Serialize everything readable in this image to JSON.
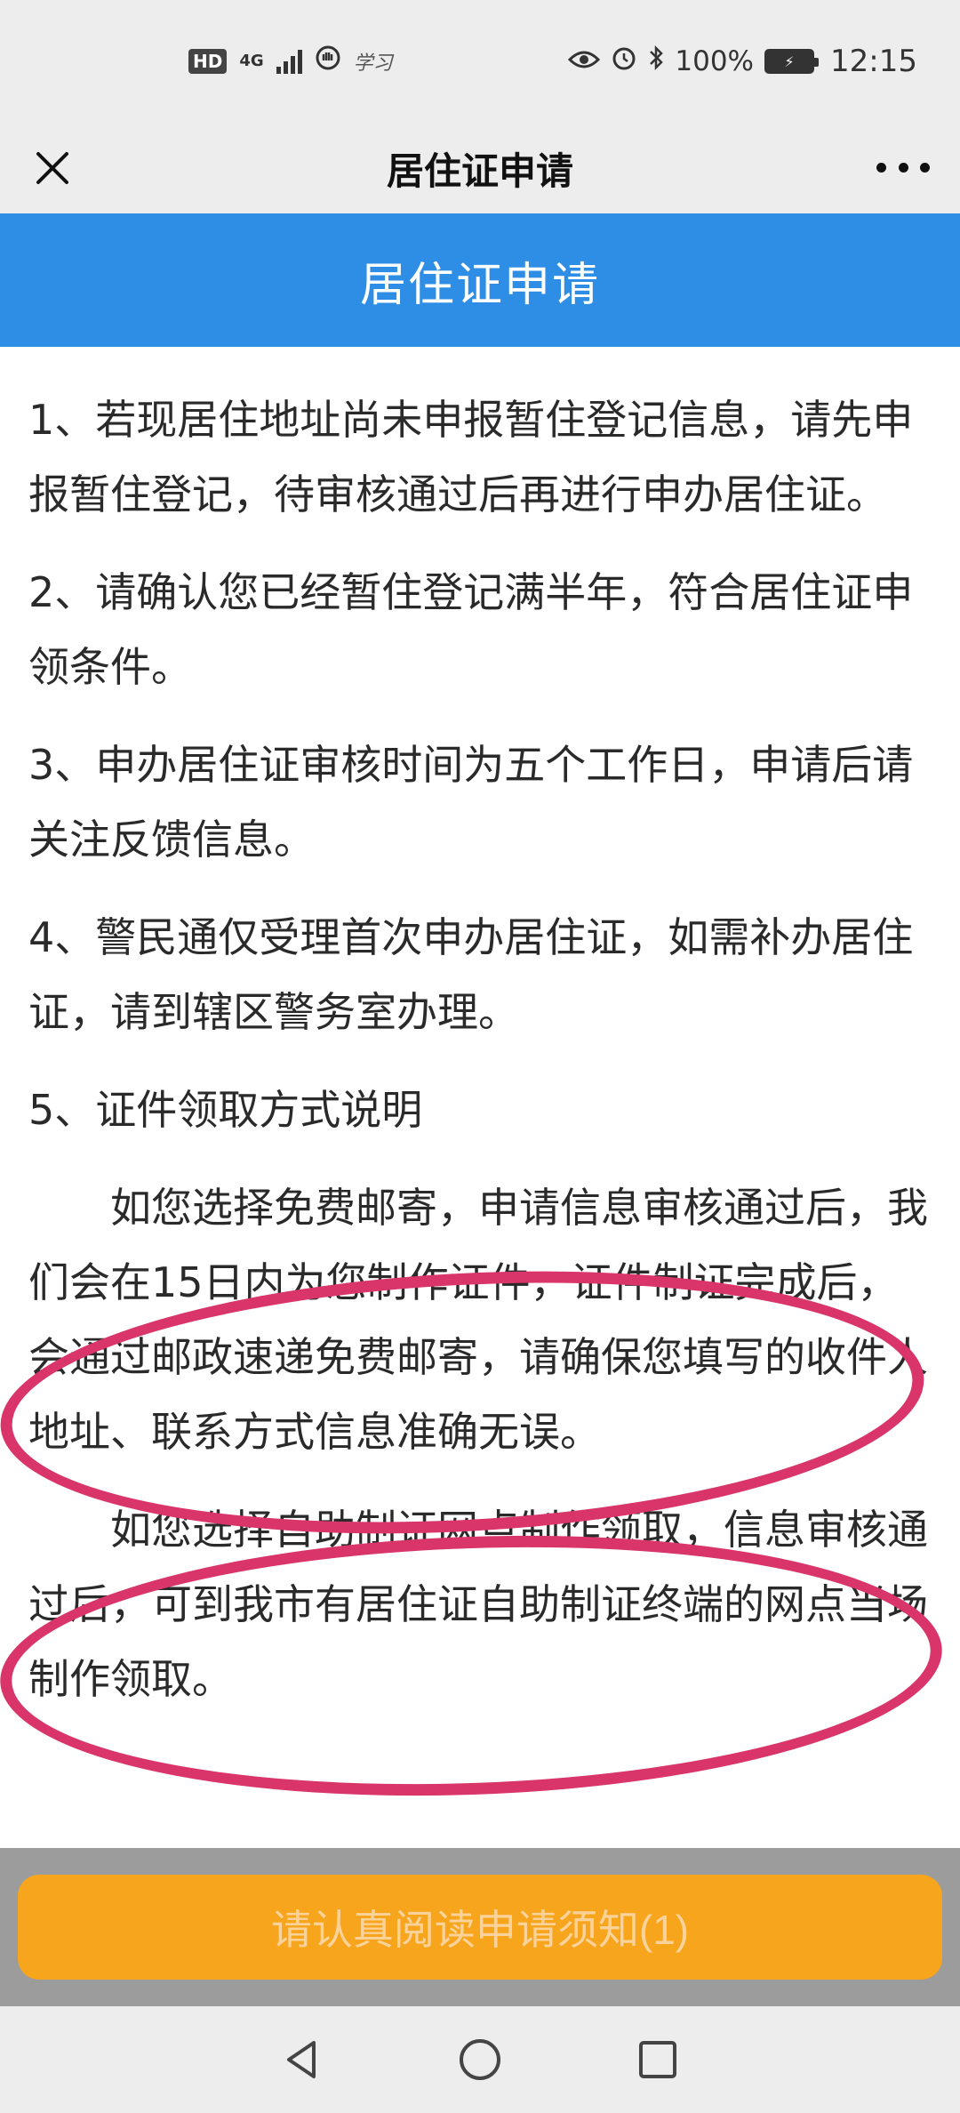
{
  "status_bar": {
    "hd": "HD",
    "network": "4G",
    "carrier": "学习",
    "battery_percent": "100%",
    "time": "12:15"
  },
  "nav": {
    "title": "居住证申请",
    "close_icon": "close-icon",
    "more_icon": "more-icon"
  },
  "header": {
    "title": "居住证申请",
    "color": "#2e8ee6"
  },
  "content": {
    "items": [
      "1、若现居住地址尚未申报暂住登记信息，请先申报暂住登记，待审核通过后再进行申办居住证。",
      "2、请确认您已经暂住登记满半年，符合居住证申领条件。",
      "3、申办居住证审核时间为五个工作日，申请后请关注反馈信息。",
      "4、警民通仅受理首次申办居住证，如需补办居住证，请到辖区警务室办理。",
      "5、证件领取方式说明"
    ],
    "sub_items": [
      "如您选择免费邮寄，申请信息审核通过后，我们会在15日内为您制作证件，证件制证完成后，会通过邮政速递免费邮寄，请确保您填写的收件人地址、联系方式信息准确无误。",
      "如您选择自助制证网点制作领取，信息审核通过后，可到我市有居住证自助制证终端的网点当场制作领取。"
    ]
  },
  "footer": {
    "button_label": "请认真阅读申请须知(1)",
    "button_color": "#f7a51c"
  },
  "annotation_color": "#d9356a"
}
